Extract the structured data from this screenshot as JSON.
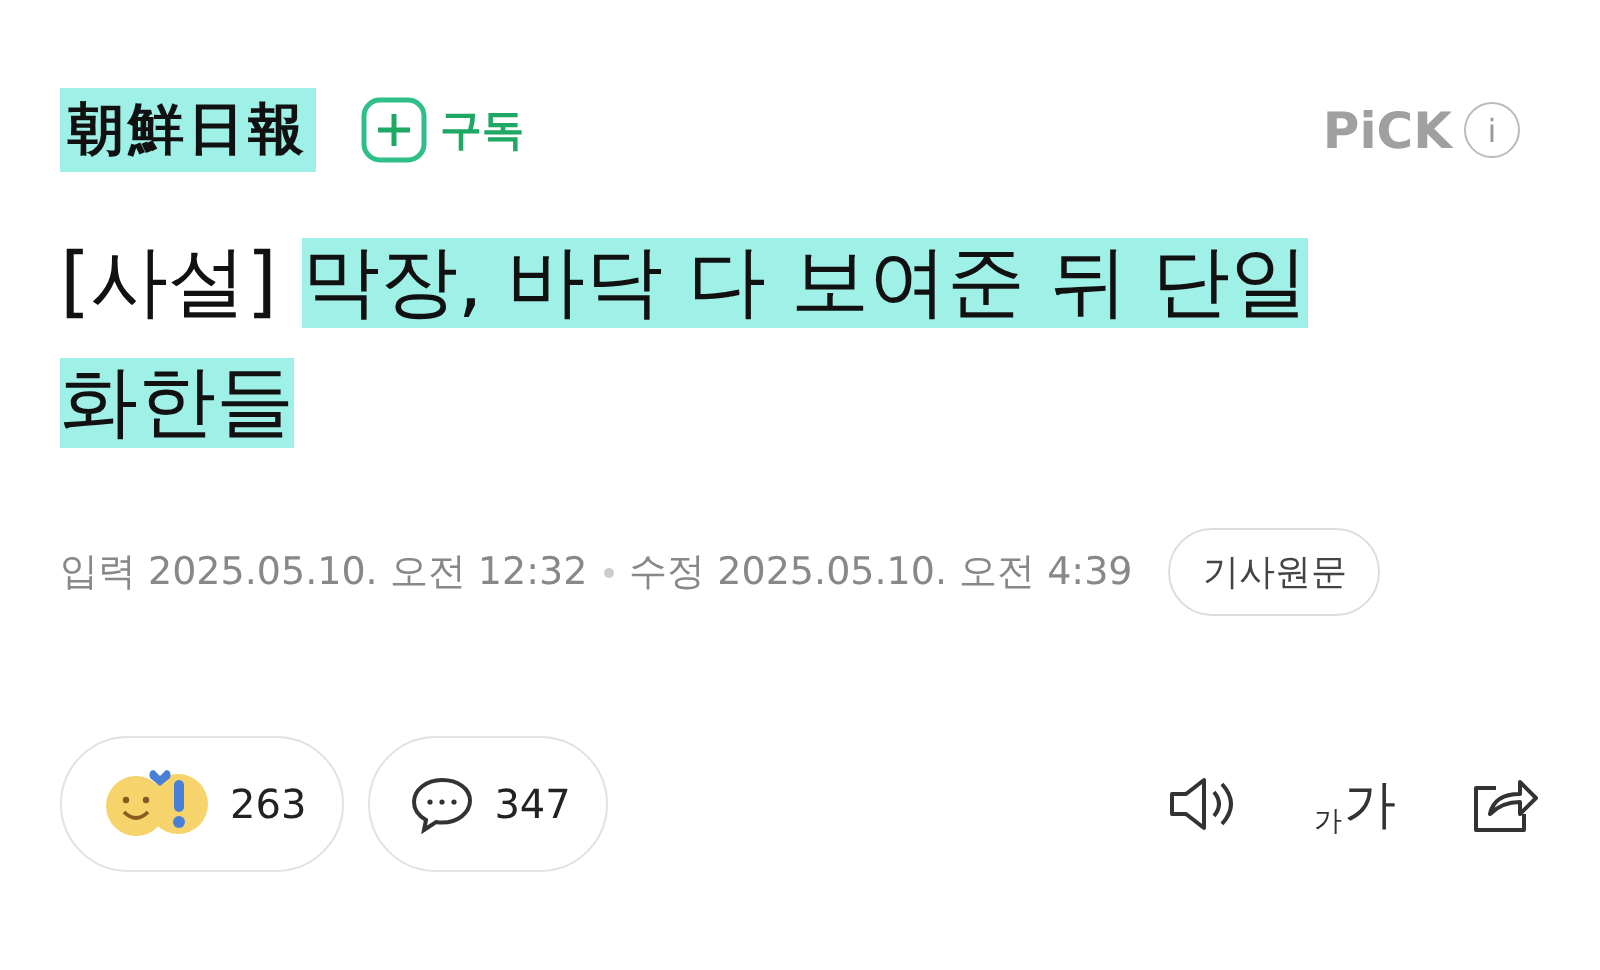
{
  "header": {
    "logo": "朝鮮日報",
    "subscribe": "구독",
    "pick": "PiCK",
    "info": "i"
  },
  "title": {
    "tag": "[사설]",
    "headline_lines": [
      "막장, 바닥 다 보여준 뒤 단일",
      "화한들"
    ]
  },
  "meta": {
    "published_label": "입력",
    "published": "2025.05.10. 오전 12:32",
    "modified_label": "수정",
    "modified": "2025.05.10. 오전 4:39",
    "original_button": "기사원문"
  },
  "actions": {
    "reactions": "263",
    "comments": "347",
    "font_small": "가",
    "font_large": "가"
  }
}
